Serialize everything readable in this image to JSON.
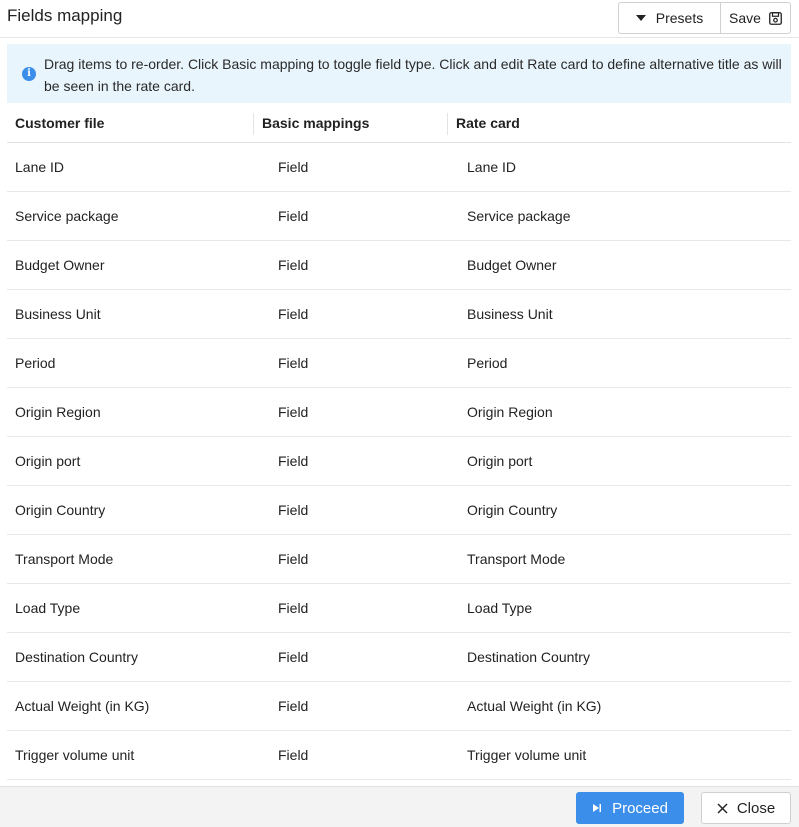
{
  "header": {
    "title": "Fields mapping",
    "presets_label": "Presets",
    "save_label": "Save"
  },
  "info": {
    "icon": "info-icon",
    "text": "Drag items to re-order. Click Basic mapping to toggle field type. Click and edit Rate card to define alternative title as will be seen in the rate card."
  },
  "table": {
    "columns": [
      "Customer file",
      "Basic mappings",
      "Rate card"
    ],
    "rows": [
      {
        "customer_file": "Lane ID",
        "basic_mapping": "Field",
        "rate_card": "Lane ID"
      },
      {
        "customer_file": "Service package",
        "basic_mapping": "Field",
        "rate_card": "Service package"
      },
      {
        "customer_file": "Budget Owner",
        "basic_mapping": "Field",
        "rate_card": "Budget Owner"
      },
      {
        "customer_file": "Business Unit",
        "basic_mapping": "Field",
        "rate_card": "Business Unit"
      },
      {
        "customer_file": "Period",
        "basic_mapping": "Field",
        "rate_card": "Period"
      },
      {
        "customer_file": "Origin Region",
        "basic_mapping": "Field",
        "rate_card": "Origin Region"
      },
      {
        "customer_file": "Origin port",
        "basic_mapping": "Field",
        "rate_card": "Origin port"
      },
      {
        "customer_file": "Origin Country",
        "basic_mapping": "Field",
        "rate_card": "Origin Country"
      },
      {
        "customer_file": "Transport Mode",
        "basic_mapping": "Field",
        "rate_card": "Transport Mode"
      },
      {
        "customer_file": "Load Type",
        "basic_mapping": "Field",
        "rate_card": "Load Type"
      },
      {
        "customer_file": "Destination Country",
        "basic_mapping": "Field",
        "rate_card": "Destination Country"
      },
      {
        "customer_file": "Actual Weight (in KG)",
        "basic_mapping": "Field",
        "rate_card": "Actual Weight (in KG)"
      },
      {
        "customer_file": "Trigger volume unit",
        "basic_mapping": "Field",
        "rate_card": "Trigger volume unit"
      }
    ]
  },
  "footer": {
    "proceed_label": "Proceed",
    "close_label": "Close"
  },
  "colors": {
    "accent": "#3b8eea",
    "info_background": "#e8f5fd"
  }
}
